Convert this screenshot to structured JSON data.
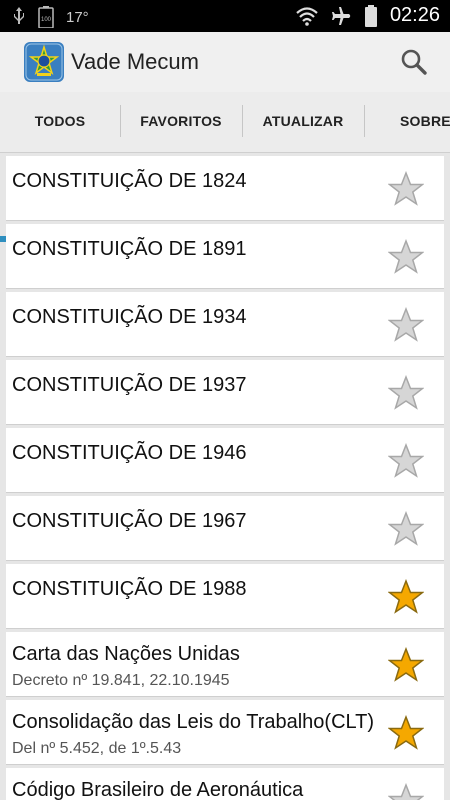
{
  "status_bar": {
    "battery_label": "100",
    "temperature": "17°",
    "time": "02:26"
  },
  "app": {
    "title": "Vade Mecum",
    "logo_icon": "brazil-coat-of-arms-icon"
  },
  "tabs": [
    {
      "label": "TODOS",
      "selected": true
    },
    {
      "label": "FAVORITOS",
      "selected": false
    },
    {
      "label": "ATUALIZAR",
      "selected": false
    },
    {
      "label": "SOBRE",
      "selected": false
    }
  ],
  "colors": {
    "accent": "#2f8fbf",
    "star_favorite": "#f5a800",
    "star_inactive": "#c8c8c8"
  },
  "items": [
    {
      "title": "CONSTITUIÇÃO DE 1824",
      "subtitle": "",
      "favorite": false
    },
    {
      "title": "CONSTITUIÇÃO DE 1891",
      "subtitle": "",
      "favorite": false
    },
    {
      "title": "CONSTITUIÇÃO DE 1934",
      "subtitle": "",
      "favorite": false
    },
    {
      "title": "CONSTITUIÇÃO DE 1937",
      "subtitle": "",
      "favorite": false
    },
    {
      "title": "CONSTITUIÇÃO DE 1946",
      "subtitle": "",
      "favorite": false
    },
    {
      "title": "CONSTITUIÇÃO DE 1967",
      "subtitle": "",
      "favorite": false
    },
    {
      "title": "CONSTITUIÇÃO DE 1988",
      "subtitle": "",
      "favorite": true
    },
    {
      "title": "Carta das Nações Unidas",
      "subtitle": "Decreto nº 19.841, 22.10.1945",
      "favorite": true
    },
    {
      "title": "Consolidação das Leis do Trabalho(CLT)",
      "subtitle": "Del nº 5.452, de 1º.5.43",
      "favorite": true
    },
    {
      "title": "Código Brasileiro de Aeronáutica",
      "subtitle": "",
      "favorite": false
    }
  ]
}
